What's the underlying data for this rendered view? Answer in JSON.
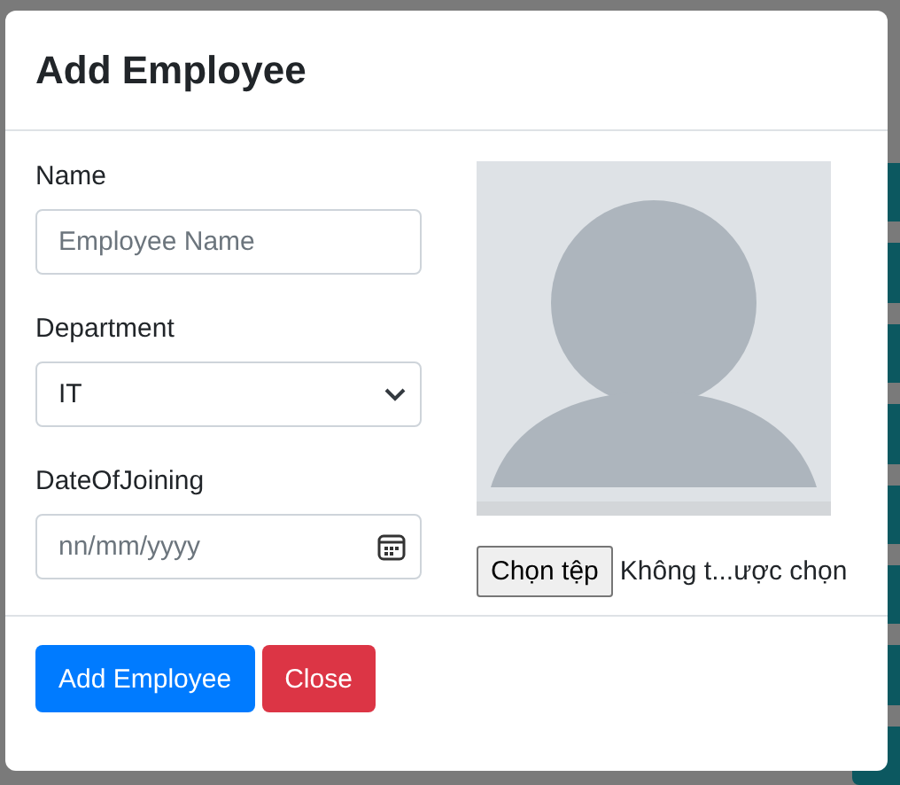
{
  "dialog": {
    "title": "Add Employee",
    "fields": [
      {
        "label": "Name",
        "kind": "text",
        "placeholder": "Employee Name"
      },
      {
        "label": "Department",
        "kind": "select",
        "value": "IT"
      },
      {
        "label": "DateOfJoining",
        "kind": "date",
        "placeholder": "nn/mm/yyyy"
      }
    ],
    "file_input": {
      "button": "Chọn tệp",
      "status": "Không t...ược chọn"
    },
    "buttons": [
      {
        "label": "Add Employee",
        "kind": "primary"
      },
      {
        "label": "Close",
        "kind": "danger"
      }
    ]
  }
}
